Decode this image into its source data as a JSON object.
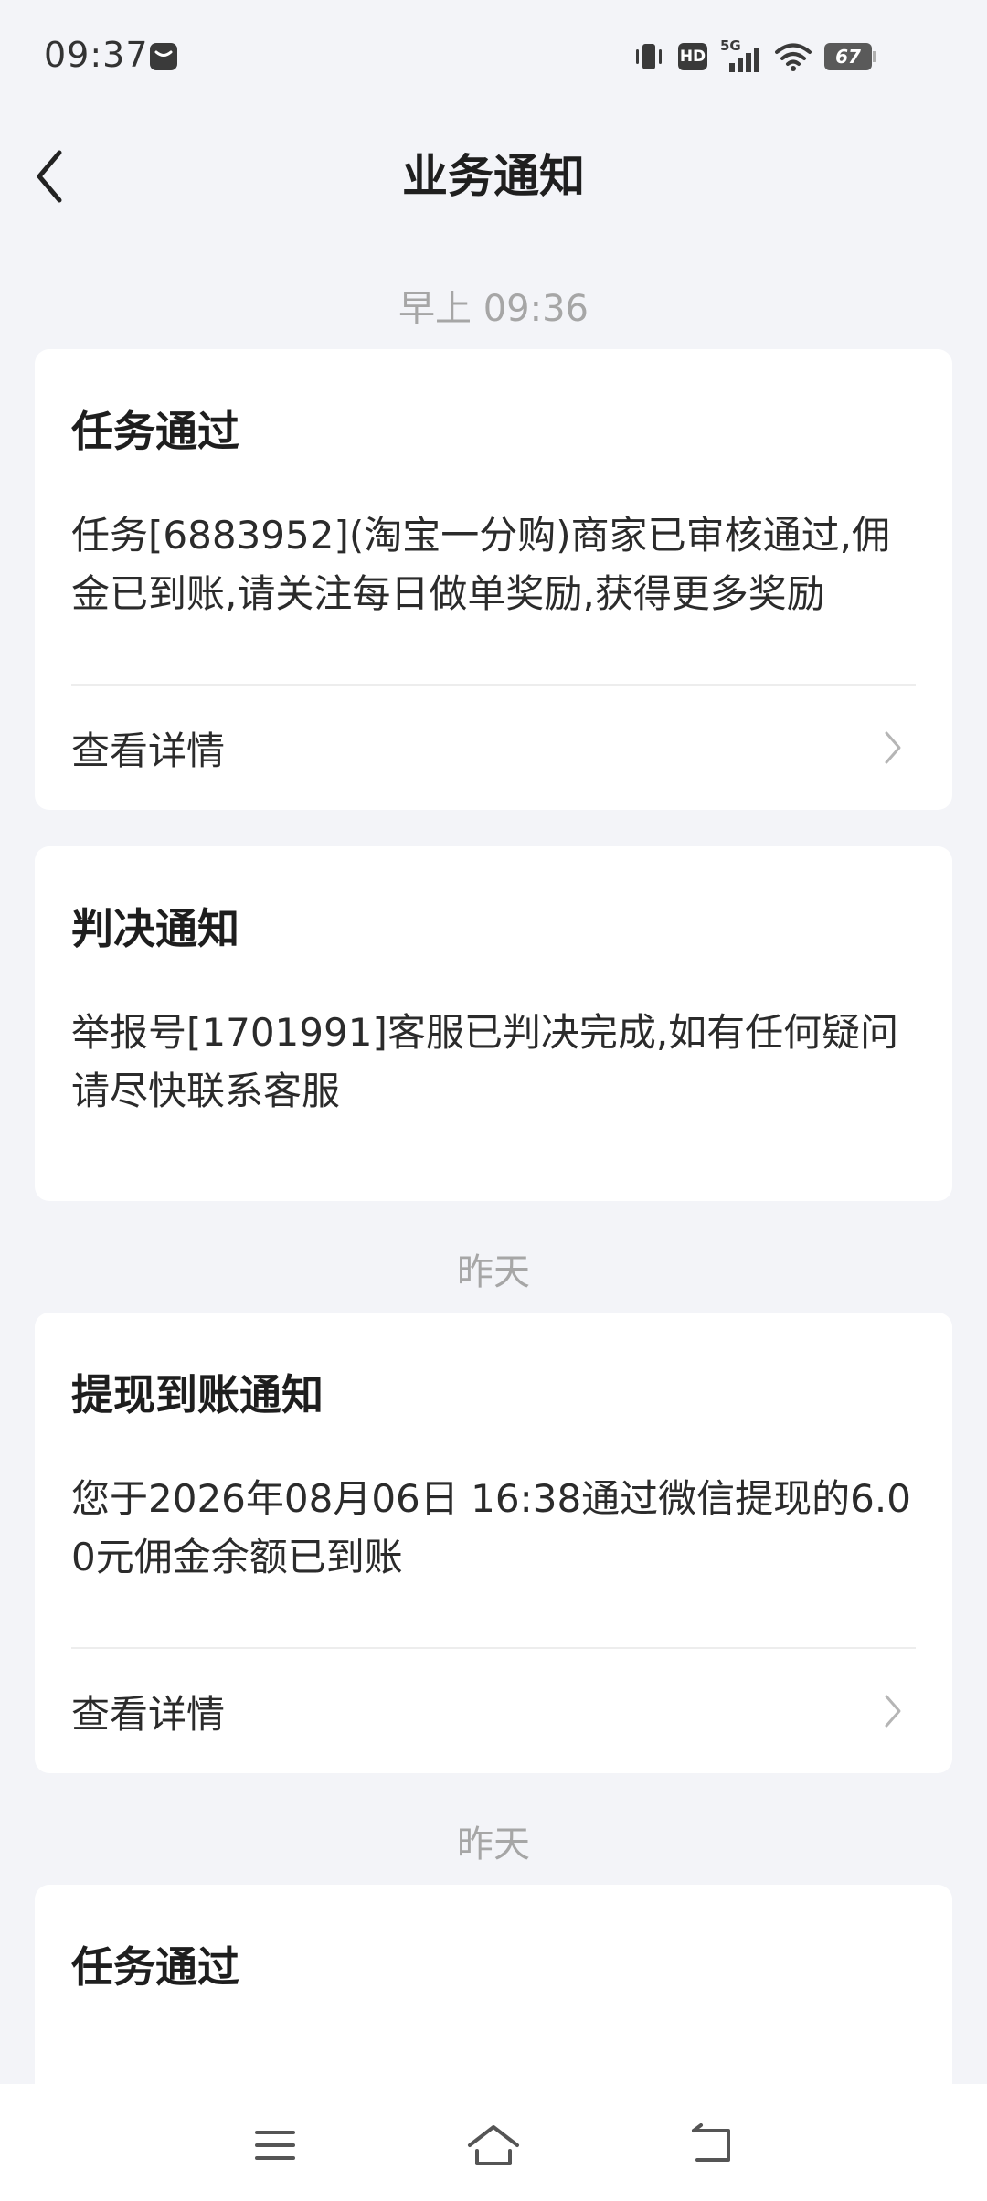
{
  "status_bar": {
    "time": "09:37",
    "network": "5G",
    "hd": "HD",
    "battery": "67",
    "icons": [
      "message-icon",
      "vibrate-icon",
      "hd-icon",
      "signal-icon",
      "wifi-icon",
      "battery-icon"
    ]
  },
  "header": {
    "title": "业务通知",
    "back_icon": "chevron-left-icon"
  },
  "groups": [
    {
      "time_label": "早上 09:36",
      "cards": [
        {
          "title": "任务通过",
          "body": "任务[6883952](淘宝一分购)商家已审核通过,佣金已到账,请关注每日做单奖励,获得更多奖励",
          "link": "查看详情"
        },
        {
          "title": "判决通知",
          "body": "举报号[1701991]客服已判决完成,如有任何疑问请尽快联系客服"
        }
      ]
    },
    {
      "time_label": "昨天",
      "cards": [
        {
          "title": "提现到账通知",
          "body": "您于2026年08月06日 16:38通过微信提现的6.00元佣金余额已到账",
          "link": "查看详情"
        }
      ]
    },
    {
      "time_label": "昨天",
      "cards": [
        {
          "title": "任务通过"
        }
      ]
    }
  ],
  "nav_bar": {
    "icons": [
      "menu-icon",
      "home-icon",
      "back-icon"
    ]
  },
  "colors": {
    "background": "#F3F4F8",
    "card": "#FFFFFF",
    "secondary_text": "#A6A6A6"
  }
}
